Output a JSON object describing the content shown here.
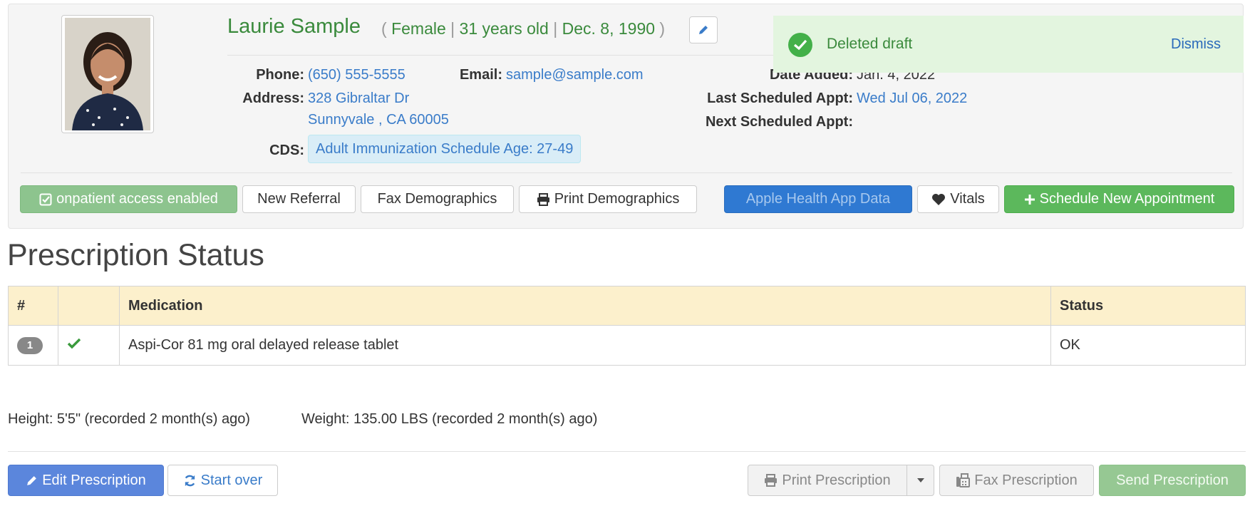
{
  "patient": {
    "name": "Laurie Sample",
    "meta_open": "(",
    "gender": "Female",
    "separator": "|",
    "age": "31 years old",
    "dob": "Dec. 8, 1990",
    "meta_close": ")"
  },
  "contact": {
    "phone_label": "Phone:",
    "phone": "(650) 555-5555",
    "email_label": "Email:",
    "email": "sample@sample.com",
    "address_label": "Address:",
    "address_line1": "328 Gibraltar Dr",
    "address_line2": "Sunnyvale , CA 60005",
    "cds_label": "CDS:",
    "cds_tag": "Adult Immunization Schedule Age: 27-49"
  },
  "dates": {
    "added_label": "Date Added:",
    "added": "Jan. 4, 2022",
    "last_appt_label": "Last Scheduled Appt:",
    "last_appt": "Wed Jul 06, 2022",
    "next_appt_label": "Next Scheduled Appt:"
  },
  "actions": {
    "onpatient": "onpatient access enabled",
    "new_referral": "New Referral",
    "fax_demographics": "Fax Demographics",
    "print_demographics": "Print Demographics",
    "apple_health": "Apple Health App Data",
    "vitals": "Vitals",
    "schedule": "Schedule New Appointment"
  },
  "toast": {
    "message": "Deleted draft",
    "dismiss": "Dismiss"
  },
  "prescription": {
    "title": "Prescription Status",
    "columns": [
      "#",
      "",
      "Medication",
      "Status"
    ],
    "rows": [
      {
        "num": "1",
        "medication": "Aspi-Cor 81 mg oral delayed release tablet",
        "status": "OK"
      }
    ]
  },
  "vitals_info": {
    "height": "Height: 5'5\" (recorded 2 month(s) ago)",
    "weight": "Weight: 135.00 LBS (recorded 2 month(s) ago)"
  },
  "footer": {
    "edit": "Edit Prescription",
    "start_over": "Start over",
    "print": "Print Prescription",
    "fax": "Fax Prescription",
    "send": "Send Prescription"
  },
  "colors": {
    "accent_green": "#3a8a3c",
    "link_blue": "#3a7cc9",
    "status_red": "#b33a2f",
    "table_header": "#fcf0cc",
    "toast_bg": "#e3f5df"
  },
  "icons": {
    "edit": "pencil-icon",
    "toast": "check-circle-icon",
    "onpatient": "check-square-icon",
    "print": "printer-icon",
    "vitals": "heart-icon",
    "schedule": "plus-icon",
    "row_check": "checkmark-icon",
    "start_over": "refresh-icon",
    "dropdown": "caret-down-icon",
    "fax": "fax-icon"
  }
}
